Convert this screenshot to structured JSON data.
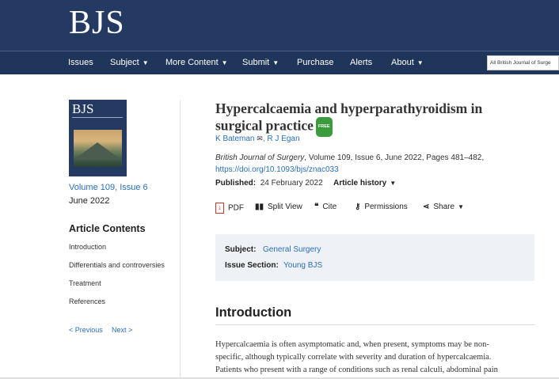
{
  "header": {
    "logo": "BJS"
  },
  "nav": {
    "items": [
      {
        "label": "Issues",
        "caret": false
      },
      {
        "label": "Subject",
        "caret": true
      },
      {
        "label": "More Content",
        "caret": true
      },
      {
        "label": "Submit",
        "caret": true
      },
      {
        "label": "Purchase",
        "caret": false
      },
      {
        "label": "Alerts",
        "caret": false
      },
      {
        "label": "About",
        "caret": true
      }
    ],
    "search_scope": "All British Journal of Surge"
  },
  "sidebar": {
    "cover_title": "BJS",
    "volume_link": "Volume 109, Issue 6",
    "issue_date": "June 2022",
    "contents_heading": "Article Contents",
    "toc": [
      "Introduction",
      "Differentials and controversies",
      "Treatment",
      "References"
    ],
    "prev_label": "< Previous",
    "next_label": "Next >"
  },
  "article": {
    "title": "Hypercalcaemia and hyperparathyroidism in surgical practice",
    "free_badge": "FREE",
    "authors": [
      "K Bateman",
      "R J Egan"
    ],
    "journal": "British Journal of Surgery",
    "citation_rest": ", Volume 109, Issue 6, June 2022, Pages 481–482,",
    "doi": "https://doi.org/10.1093/bjs/znac033",
    "published_label": "Published:",
    "published_date": "24 February 2022",
    "history_label": "Article history"
  },
  "toolbar": {
    "pdf": "PDF",
    "split": "Split View",
    "cite": "Cite",
    "permissions": "Permissions",
    "share": "Share"
  },
  "subject_box": {
    "subject_label": "Subject:",
    "subject_value": "General Surgery",
    "section_label": "Issue Section:",
    "section_value": "Young BJS"
  },
  "intro": {
    "heading": "Introduction",
    "line1": "Hypercalcaemia is often asymptomatic and, when present, symptoms may be non-",
    "line2": "specific, although typically correlate with severity and duration of hypercalcaemia.",
    "line3": "Patients who present with a range of conditions such as renal calculi, abdominal pain"
  },
  "colors": {
    "header_bg": "#243a63",
    "nav_bg": "#1f3559",
    "link": "#2a6ebb",
    "free_badge": "#3c9b3c"
  }
}
